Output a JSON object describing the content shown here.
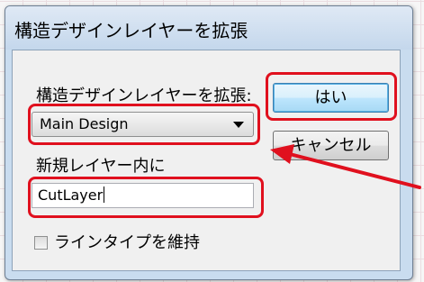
{
  "dialog": {
    "title": "構造デザインレイヤーを拡張"
  },
  "form": {
    "source_label": "構造デザインレイヤーを拡張:",
    "source_select": {
      "selected": "Main Design"
    },
    "target_label": "新規レイヤー内に",
    "target_input": {
      "value": "CutLayer"
    },
    "keep_linetype_label": "ラインタイプを維持",
    "keep_linetype_checked": false
  },
  "buttons": {
    "ok_label": "はい",
    "cancel_label": "キャンセル"
  },
  "annotations": {
    "highlight_color": "#e0101e",
    "arrow_color": "#e0101e"
  },
  "icons": {
    "dropdown_arrow": "chevron-down-icon",
    "annotation_arrow": "red-arrow-icon"
  }
}
